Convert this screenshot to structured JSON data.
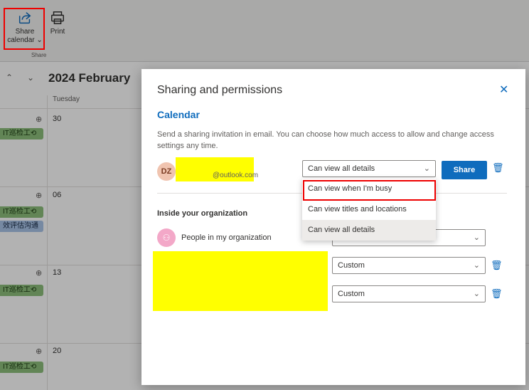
{
  "ribbon": {
    "share_label_1": "Share",
    "share_label_2": "calendar",
    "print_label": "Print",
    "group_label": "Share"
  },
  "calendar": {
    "month_title": "2024 February",
    "day_header": "Tuesday",
    "dates": [
      "30",
      "06",
      "13",
      "20"
    ],
    "event_it": "IT巡检工⟲",
    "event_blue": "效评估沟通"
  },
  "modal": {
    "title": "Sharing and permissions",
    "section_calendar": "Calendar",
    "description": "Send a sharing invitation in email. You can choose how much access to allow and change access settings any time.",
    "invitee_initials": "DZ",
    "invitee_email_suffix": "@outlook.com",
    "invitee_permission": "Can view all details",
    "share_button": "Share",
    "section_inside": "Inside your organization",
    "people_label": "People in my organization",
    "custom_1": "Custom",
    "custom_2": "Custom"
  },
  "permission_menu": {
    "options": [
      "Can view when I'm busy",
      "Can view titles and locations",
      "Can view all details"
    ],
    "selected": "Can view all details",
    "highlighted": "Can view when I'm busy"
  },
  "colors": {
    "accent": "#0f6cbd",
    "highlight_outline": "#e00000",
    "redaction": "#ffff00"
  },
  "icons": [
    "share-icon",
    "print-icon",
    "chevron-down-icon",
    "chevron-up-icon",
    "close-icon",
    "trash-icon",
    "people-icon",
    "add-event-icon"
  ]
}
